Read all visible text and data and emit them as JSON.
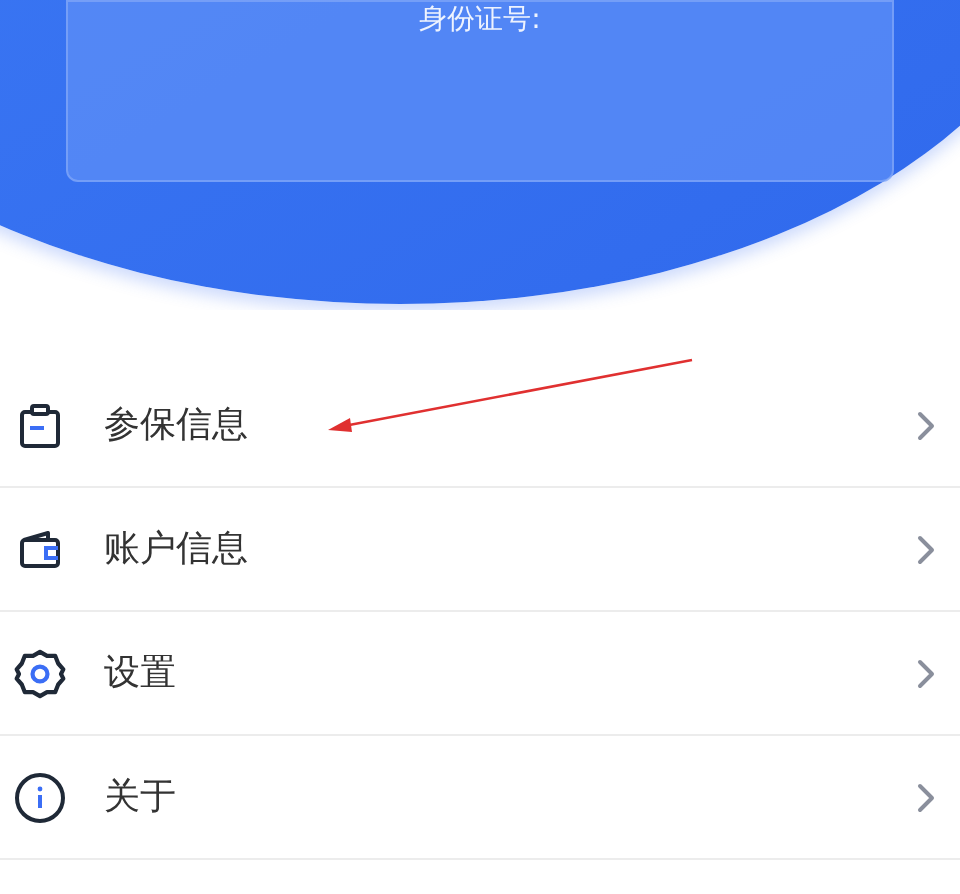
{
  "card": {
    "label": "身份证号:"
  },
  "menu": [
    {
      "kind": "clipboard",
      "label": "参保信息"
    },
    {
      "kind": "wallet",
      "label": "账户信息"
    },
    {
      "kind": "gear",
      "label": "设置"
    },
    {
      "kind": "info",
      "label": "关于"
    }
  ]
}
